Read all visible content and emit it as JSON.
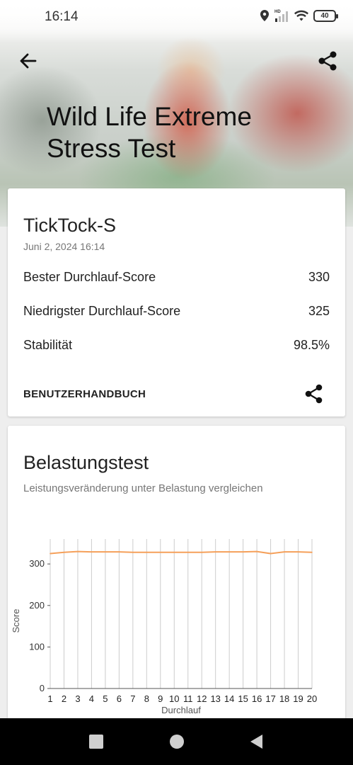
{
  "status": {
    "time": "16:14",
    "battery": "40"
  },
  "hero": {
    "title": "Wild Life Extreme Stress Test"
  },
  "result": {
    "device": "TickTock-S",
    "date": "Juni 2, 2024 16:14",
    "rows": [
      {
        "label": "Bester Durchlauf-Score",
        "value": "330"
      },
      {
        "label": "Niedrigster Durchlauf-Score",
        "value": "325"
      },
      {
        "label": "Stabilität",
        "value": "98.5%"
      }
    ],
    "manual_label": "BENUTZERHANDBUCH"
  },
  "stress": {
    "title": "Belastungstest",
    "subtitle": "Leistungsveränderung unter Belastung vergleichen"
  },
  "colors": {
    "accent": "#f5a05a",
    "grid": "#cccccc",
    "axis": "#555555"
  },
  "chart_data": {
    "type": "line",
    "xlabel": "Durchlauf",
    "ylabel": "Score",
    "x": [
      1,
      2,
      3,
      4,
      5,
      6,
      7,
      8,
      9,
      10,
      11,
      12,
      13,
      14,
      15,
      16,
      17,
      18,
      19,
      20
    ],
    "series": [
      {
        "values": [
          325,
          328,
          330,
          329,
          329,
          329,
          328,
          328,
          328,
          328,
          328,
          328,
          329,
          329,
          329,
          330,
          325,
          329,
          329,
          328
        ]
      }
    ],
    "yticks": [
      0,
      100,
      200,
      300
    ],
    "ylim": [
      0,
      360
    ],
    "grid": "vertical"
  }
}
